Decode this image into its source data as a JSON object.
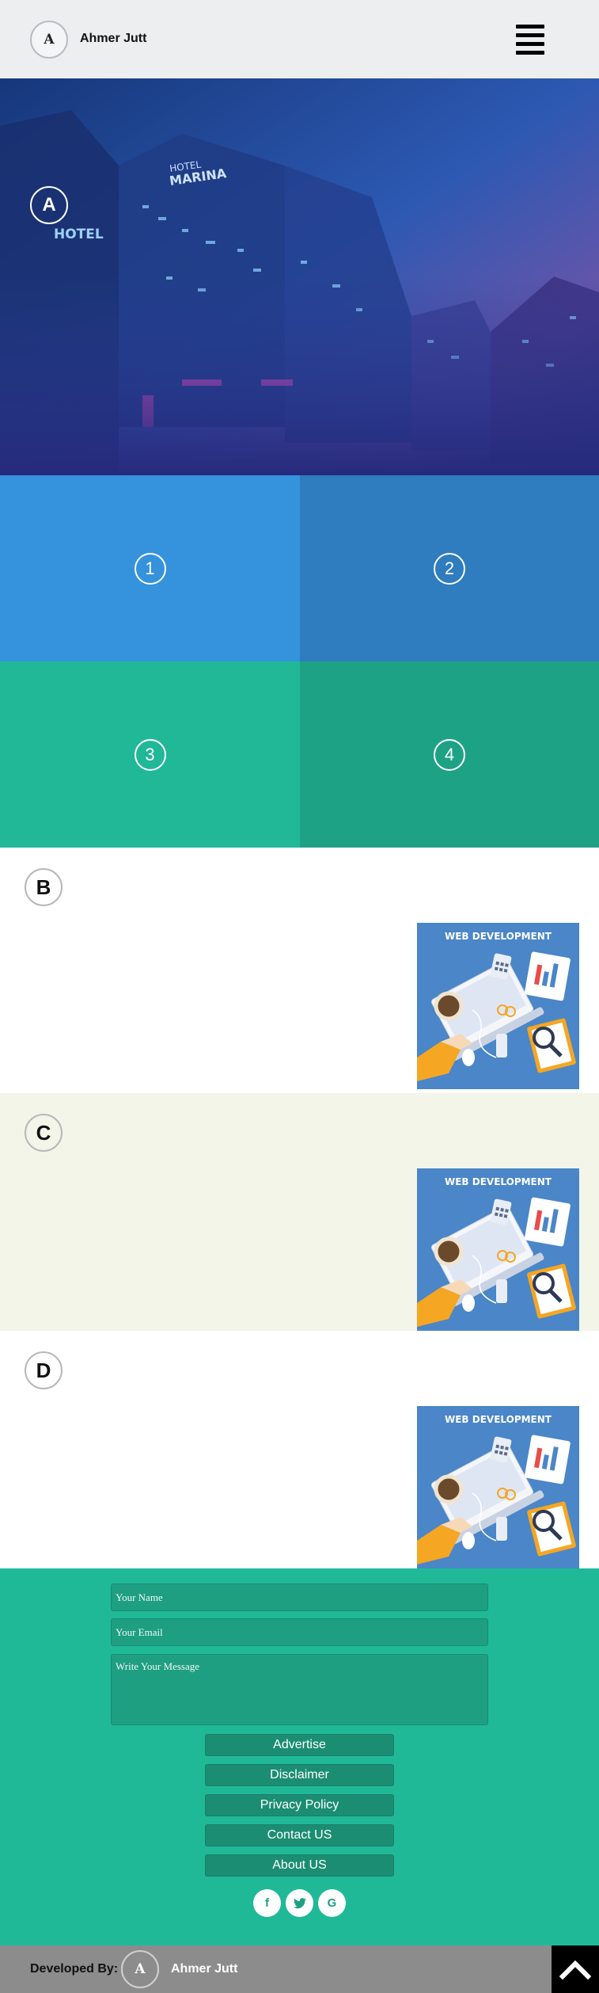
{
  "header": {
    "logo_letter": "A",
    "brand_name": "Ahmer Jutt",
    "menu_icon": "hamburger-menu-icon"
  },
  "hero": {
    "badge": "A",
    "sign_texts": [
      "HOTEL",
      "MARINA",
      "HOTEL"
    ]
  },
  "grid": {
    "tiles": [
      "1",
      "2",
      "3",
      "4"
    ],
    "colors": [
      "#3592dc",
      "#2f7cbf",
      "#21b897",
      "#1ea286"
    ]
  },
  "sections": [
    {
      "badge": "B",
      "image_title": "WEB DEVELOPMENT"
    },
    {
      "badge": "C",
      "image_title": "WEB DEVELOPMENT"
    },
    {
      "badge": "D",
      "image_title": "WEB DEVELOPMENT"
    }
  ],
  "contact_form": {
    "name_placeholder": "Your Name",
    "email_placeholder": "Your Email",
    "message_placeholder": "Write Your Message"
  },
  "footer_links": [
    "Advertise",
    "Disclaimer",
    "Privacy Policy",
    "Contact US",
    "About US"
  ],
  "social": [
    {
      "icon": "facebook-icon",
      "glyph": "f"
    },
    {
      "icon": "twitter-icon",
      "glyph": "t"
    },
    {
      "icon": "google-icon",
      "glyph": "G"
    }
  ],
  "bottom_bar": {
    "developed_by": "Developed By:",
    "logo_letter": "A",
    "developer_name": "Ahmer Jutt",
    "scroll_top_icon": "chevron-up-icon"
  },
  "colors": {
    "header_bg": "#eceef0",
    "footer_bg": "#20b998",
    "bottom_bar_bg": "#8c8c8c"
  }
}
